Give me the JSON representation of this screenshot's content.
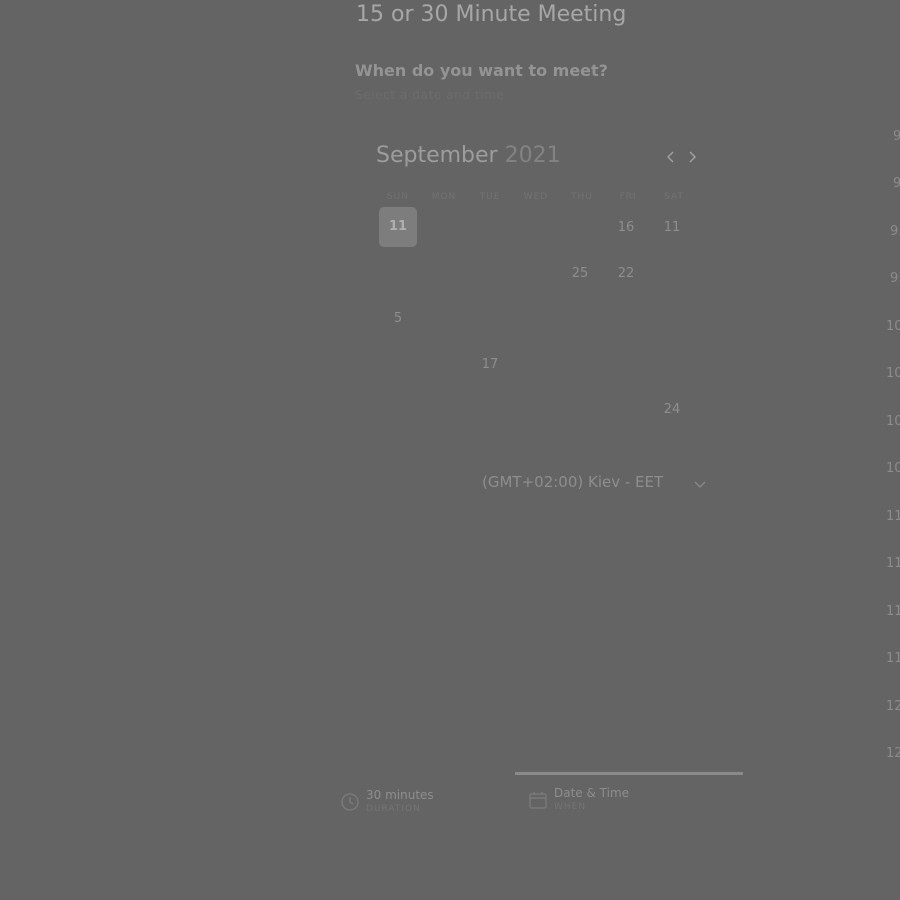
{
  "meeting": {
    "title": "15 or 30 Minute Meeting"
  },
  "prompt": {
    "question": "When do you want to meet?",
    "subtitle": "Select a date and time"
  },
  "calendar": {
    "month": "September",
    "year": "2021",
    "weekdays": [
      "SUN",
      "MON",
      "TUE",
      "WED",
      "THU",
      "FRI",
      "SAT"
    ],
    "days": [
      {
        "label": "11",
        "selected": true
      },
      {
        "label": "16",
        "selected": false
      },
      {
        "label": "11",
        "selected": false
      },
      {
        "label": "25",
        "selected": false
      },
      {
        "label": "22",
        "selected": false
      },
      {
        "label": "5",
        "selected": false
      },
      {
        "label": "17",
        "selected": false
      },
      {
        "label": "24",
        "selected": false
      }
    ]
  },
  "timezone": {
    "value": "(GMT+02:00) Kiev - EET"
  },
  "times": [
    "9",
    "9",
    "9:",
    "9:",
    "10",
    "10",
    "10",
    "10",
    "11",
    "11",
    "11",
    "11",
    "12",
    "12"
  ],
  "footer": {
    "duration_title": "30 minutes",
    "duration_sub": "DURATION",
    "datetime_title": "Date & Time",
    "datetime_sub": "WHEN"
  },
  "colors": {
    "background": "#646464",
    "selected_day": "#7d7d7d",
    "progress": "#8a8a8a"
  },
  "icons": [
    "chevron-left-icon",
    "chevron-right-icon",
    "chevron-down-icon",
    "clock-icon",
    "calendar-icon"
  ]
}
